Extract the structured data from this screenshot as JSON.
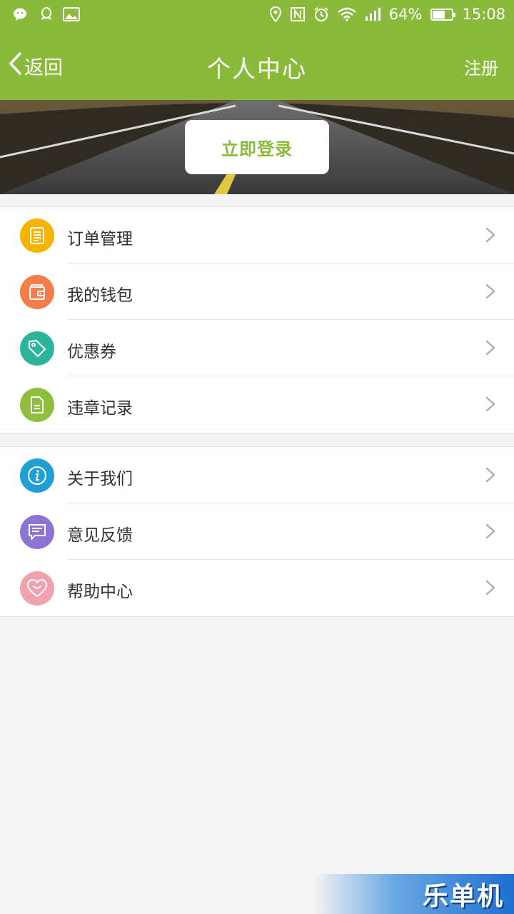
{
  "status_bar": {
    "battery_percent": "64%",
    "battery_level": 0.64,
    "time": "15:08",
    "left_icons": [
      "wechat-icon",
      "qq-icon",
      "image-icon"
    ],
    "right_icons": [
      "location-icon",
      "nfc-icon",
      "alarm-icon",
      "wifi-icon",
      "signal-icon",
      "battery-icon"
    ]
  },
  "navbar": {
    "back_label": "返回",
    "title": "个人中心",
    "register_label": "注册"
  },
  "banner": {
    "login_button": "立即登录"
  },
  "menu_groups": [
    {
      "items": [
        {
          "label": "订单管理",
          "icon": "order-list-icon",
          "color": "#f5b400"
        },
        {
          "label": "我的钱包",
          "icon": "wallet-icon",
          "color": "#f47d4a"
        },
        {
          "label": "优惠券",
          "icon": "coupon-tag-icon",
          "color": "#2bb59a"
        },
        {
          "label": "违章记录",
          "icon": "document-icon",
          "color": "#8dbf3d"
        }
      ]
    },
    {
      "items": [
        {
          "label": "关于我们",
          "icon": "info-icon",
          "color": "#1f9fd6"
        },
        {
          "label": "意见反馈",
          "icon": "message-icon",
          "color": "#8d74d3"
        },
        {
          "label": "帮助中心",
          "icon": "heart-icon",
          "color": "#f0a3ad"
        }
      ]
    }
  ],
  "colors": {
    "brand_green": "#8aba3c",
    "background": "#f4f4f4"
  },
  "watermark": "乐单机"
}
